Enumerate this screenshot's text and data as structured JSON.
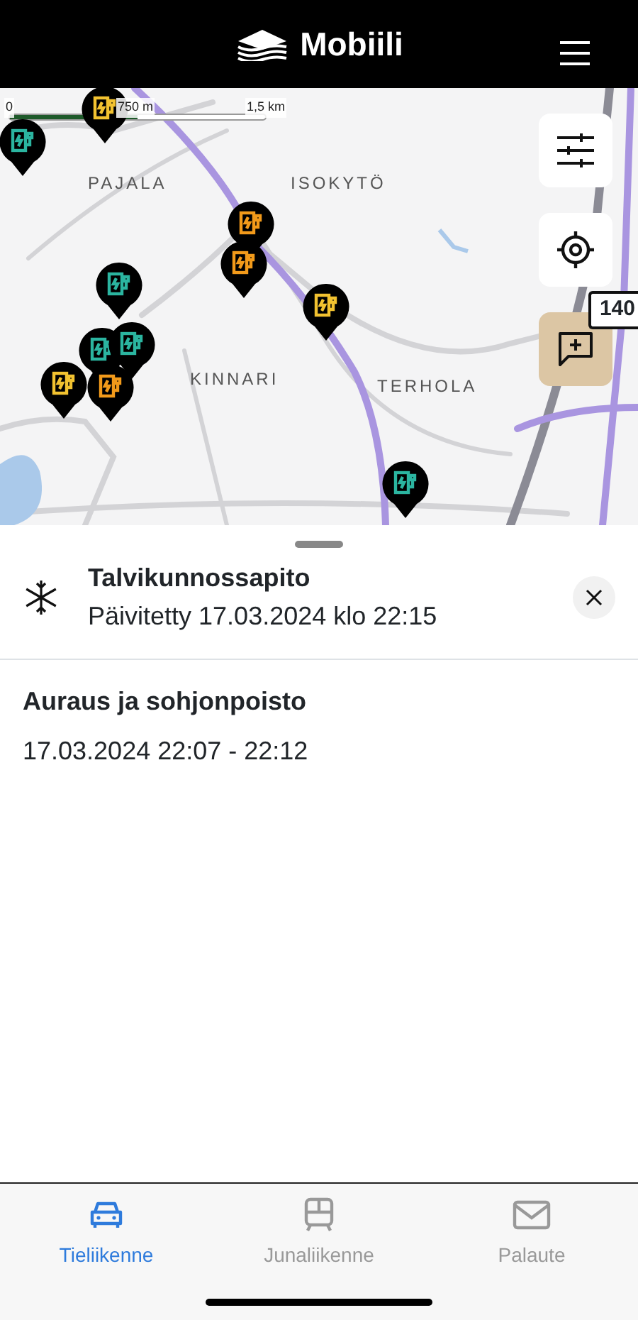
{
  "header": {
    "title": "Mobiili"
  },
  "map": {
    "scale": [
      "0",
      "750 m",
      "1,5 km"
    ],
    "places": [
      "PAJALA",
      "ISOKYTÖ",
      "KINNARI",
      "TERHOLA"
    ],
    "road_sign": "140",
    "markers": [
      {
        "color": "#2bb5a0"
      },
      {
        "color": "#f2c230"
      },
      {
        "color": "#f29a1a"
      },
      {
        "color": "#f29a1a"
      },
      {
        "color": "#2bb5a0"
      },
      {
        "color": "#f2c230"
      },
      {
        "color": "#2bb5a0"
      },
      {
        "color": "#2bb5a0"
      },
      {
        "color": "#f2c230"
      },
      {
        "color": "#f29a1a"
      },
      {
        "color": "#2bb5a0"
      }
    ]
  },
  "sheet": {
    "title": "Talvikunnossapito",
    "updated": "Päivitetty 17.03.2024 klo 22:15",
    "entries": [
      {
        "title": "Auraus ja sohjonpoisto",
        "time": "17.03.2024 22:07 - 22:12"
      }
    ]
  },
  "tabs": [
    {
      "label": "Tieliikenne",
      "selected": true
    },
    {
      "label": "Junaliikenne",
      "selected": false
    },
    {
      "label": "Palaute",
      "selected": false
    }
  ]
}
